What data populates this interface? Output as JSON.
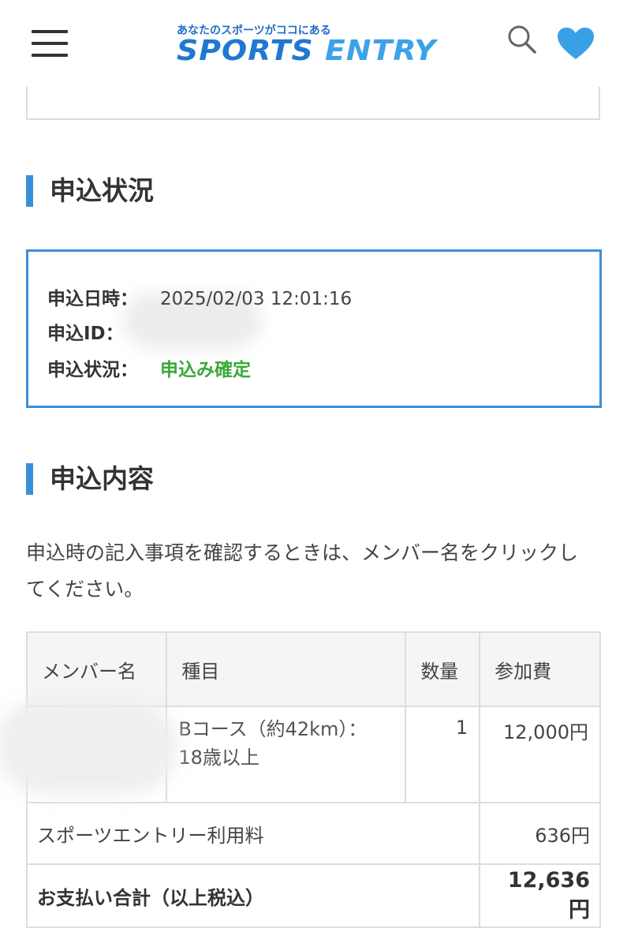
{
  "header": {
    "logo_tagline": "あなたのスポーツがココにある",
    "logo_word1": "SPORTS",
    "logo_word2": "ENTRY",
    "accent_color": "#3a8fd9",
    "icons": [
      "hamburger-menu-icon",
      "search-icon",
      "heart-icon"
    ]
  },
  "status_section": {
    "title": "申込状況",
    "date_label": "申込日時：",
    "date_value": "2025/02/03 12:01:16",
    "id_label": "申込ID：",
    "status_label": "申込状況：",
    "status_value": "申込み確定",
    "status_color": "#3aa838"
  },
  "content_section": {
    "title": "申込内容",
    "description": "申込時の記入事項を確認するときは、メンバー名をクリックしてください。"
  },
  "table": {
    "headers": {
      "member": "メンバー名",
      "event": "種目",
      "quantity": "数量",
      "fee": "参加費"
    },
    "item": {
      "event_line1": "Bコース（約42km）：",
      "event_line2": "18歳以上",
      "quantity": "1",
      "fee": "12,000円"
    },
    "usage_fee_label": "スポーツエントリー利用料",
    "usage_fee_value": "636円",
    "total_label": "お支払い合計（以上税込）",
    "total_value": "12,636円"
  }
}
